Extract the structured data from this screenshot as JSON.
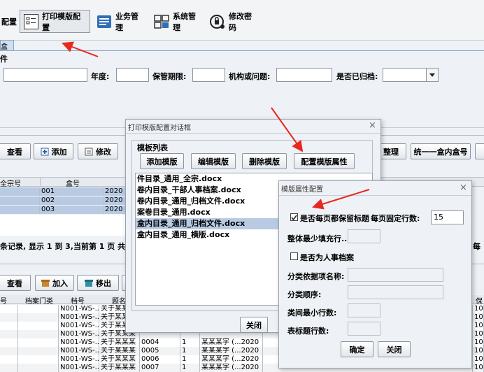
{
  "toolbar": {
    "items": [
      {
        "label": "配置"
      },
      {
        "label": "打印模版配置"
      },
      {
        "label": "业务管理"
      },
      {
        "label": "系统管理"
      },
      {
        "label": "修改密码"
      }
    ]
  },
  "tab": {
    "label": "盒"
  },
  "panel_label": "件",
  "search": {
    "year_label": "年度:",
    "retention_label": "保管期限:",
    "issue_label": "机构或问题:",
    "archived_label": "是否已归档:"
  },
  "main_actions": {
    "view": "查看",
    "add": "添加",
    "edit": "修改",
    "organize": "整理",
    "unify": "统一一盒内盒号"
  },
  "grid_top": {
    "headers": [
      "全宗号",
      "盒号"
    ],
    "rows": [
      {
        "box": "001",
        "year": "2020"
      },
      {
        "box": "002",
        "year": "2020"
      },
      {
        "box": "003",
        "year": "2020"
      }
    ],
    "status": "条记录, 显示 1 到 3,当前第 1 页 共 1 页",
    "right_edge_text": "每"
  },
  "bottom_actions": {
    "view": "查看",
    "join": "加入",
    "remove": "移出"
  },
  "grid_bottom": {
    "headers": [
      "号",
      "档案门类",
      "档号",
      "题名",
      "保"
    ],
    "rows": [
      {
        "code": "N001-WS-...",
        "title": "关于某某某",
        "num": "",
        "p": "",
        "resp": "",
        "val": "10"
      },
      {
        "code": "N001-WS-...",
        "title": "关于某某某",
        "num": "",
        "p": "",
        "resp": "",
        "val": "10"
      },
      {
        "code": "N001-WS-...",
        "title": "关于某某某",
        "num": "",
        "p": "",
        "resp": "",
        "val": "10"
      },
      {
        "code": "N001-WS-...",
        "title": "关于某某某",
        "num": "",
        "p": "",
        "resp": "",
        "val": "10"
      },
      {
        "code": "N001-WS-...",
        "title": "关于某某某",
        "num": "0004",
        "p": "1",
        "resp": "某某某字 (...2020",
        "val": "10"
      },
      {
        "code": "N001-WS-...",
        "title": "关于某某某",
        "num": "0005",
        "p": "1",
        "resp": "某某某字 (...2020",
        "val": "10"
      },
      {
        "code": "N001-WS-...",
        "title": "关于某某某",
        "num": "0006",
        "p": "1",
        "resp": "某某某字 (...2020",
        "val": "10"
      },
      {
        "code": "N001-WS-...",
        "title": "关于某某某",
        "num": "0007",
        "p": "1",
        "resp": "某某某字 (...2020",
        "val": "10"
      }
    ]
  },
  "template_dialog": {
    "title": "打印模版配置对话框",
    "group_label": "模板列表",
    "buttons": {
      "add": "添加模版",
      "edit": "编辑模版",
      "delete": "删除模版",
      "config": "配置模版属性"
    },
    "templates": [
      "件目录_通用_全宗.docx",
      "卷内目录_干部人事档案.docx",
      "卷内目录_通用_归档文件.docx",
      "案卷目录_通用.docx",
      "盒内目录_通用_归档文件.docx",
      "盒内目录_通用_横版.docx"
    ],
    "selected_index": 4,
    "close": "关闭"
  },
  "property_dialog": {
    "title": "模版属性配置",
    "keep_title_label": "是否每页都保留标题",
    "keep_title_checked": true,
    "fixed_rows_label": "每页固定行数:",
    "fixed_rows_value": "15",
    "min_fill_label": "整体最少填充行...",
    "personnel_label": "是否为人事档案",
    "personnel_checked": false,
    "category_name_label": "分类依据项名称:",
    "category_order_label": "分类顺序:",
    "min_rows_label": "类间最小行数:",
    "header_rows_label": "表标题行数:",
    "confirm": "确定",
    "close": "关闭"
  },
  "colors": {
    "arrow": "#e8281e",
    "selection": "#b9cbe3",
    "accent": "#2f5fa8"
  }
}
